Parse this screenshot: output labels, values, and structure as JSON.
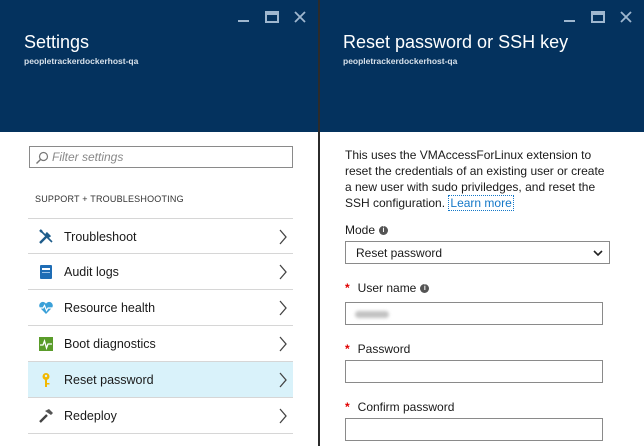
{
  "settings_blade": {
    "title": "Settings",
    "subtitle": "peopletrackerdockerhost-qa",
    "search": {
      "placeholder": "Filter settings",
      "value": ""
    },
    "section_heading": "SUPPORT + TROUBLESHOOTING",
    "items": [
      {
        "label": "Troubleshoot",
        "icon": "wrench-screwdriver-icon",
        "selected": false
      },
      {
        "label": "Audit logs",
        "icon": "log-book-icon",
        "selected": false
      },
      {
        "label": "Resource health",
        "icon": "heart-pulse-icon",
        "selected": false
      },
      {
        "label": "Boot diagnostics",
        "icon": "diagnostics-chart-icon",
        "selected": false
      },
      {
        "label": "Reset password",
        "icon": "key-icon",
        "selected": true
      },
      {
        "label": "Redeploy",
        "icon": "hammer-icon",
        "selected": false
      }
    ]
  },
  "reset_blade": {
    "title": "Reset password or SSH key",
    "subtitle": "peopletrackerdockerhost-qa",
    "description": "This uses the VMAccessForLinux extension to reset the credentials of an existing user or create a new user with sudo priviledges, and reset the SSH configuration.",
    "learn_more": "Learn more",
    "mode": {
      "label": "Mode",
      "value": "Reset password"
    },
    "username": {
      "label": "User name",
      "value": ""
    },
    "password": {
      "label": "Password",
      "value": ""
    },
    "confirm_password": {
      "label": "Confirm password",
      "value": ""
    }
  },
  "colors": {
    "header_bg": "#04325e",
    "selected_bg": "#d9f2fa",
    "link": "#1478c8",
    "required": "#e00000"
  }
}
